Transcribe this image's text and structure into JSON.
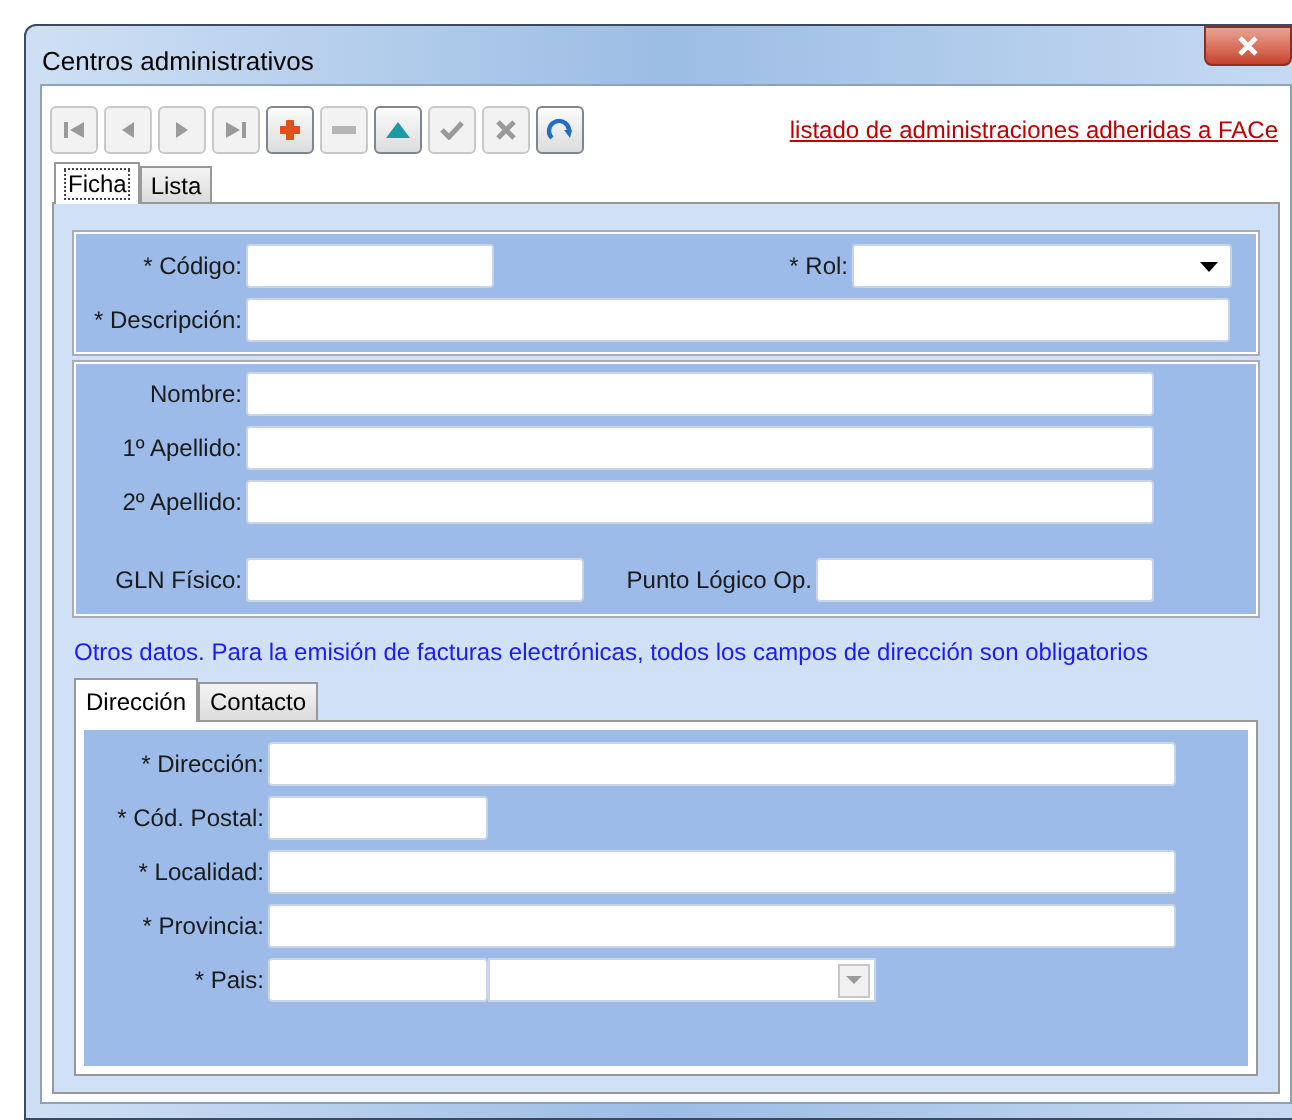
{
  "window": {
    "title": "Centros administrativos"
  },
  "toolbar": [
    {
      "kind": "first",
      "disabled": true
    },
    {
      "kind": "prev",
      "disabled": true
    },
    {
      "kind": "next",
      "disabled": true
    },
    {
      "kind": "last",
      "disabled": true
    },
    {
      "kind": "add",
      "disabled": false
    },
    {
      "kind": "remove",
      "disabled": true
    },
    {
      "kind": "up",
      "disabled": false
    },
    {
      "kind": "accept",
      "disabled": true
    },
    {
      "kind": "cancel",
      "disabled": true
    },
    {
      "kind": "refresh",
      "disabled": false
    }
  ],
  "link": "listado de administraciones adheridas a FACe",
  "tabs": [
    {
      "label": "Ficha",
      "selected": true
    },
    {
      "label": "Lista",
      "selected": false
    }
  ],
  "identity": {
    "code": "* Código:",
    "role": "* Rol:",
    "description": "* Descripción:"
  },
  "person": {
    "name": "Nombre:",
    "surname1": "1º Apellido:",
    "surname2": "2º Apellido:",
    "gln": "GLN Físico:",
    "logical_point": "Punto Lógico Op."
  },
  "note": "Otros datos. Para la emisión de facturas electrónicas, todos los campos de dirección son obligatorios",
  "subtabs": [
    {
      "label": "Dirección",
      "selected": true
    },
    {
      "label": "Contacto",
      "selected": false
    }
  ],
  "address": {
    "street": "* Dirección:",
    "postal_code": "* Cód. Postal:",
    "city": "* Localidad:",
    "province": "* Provincia:",
    "country": "* Pais:"
  }
}
